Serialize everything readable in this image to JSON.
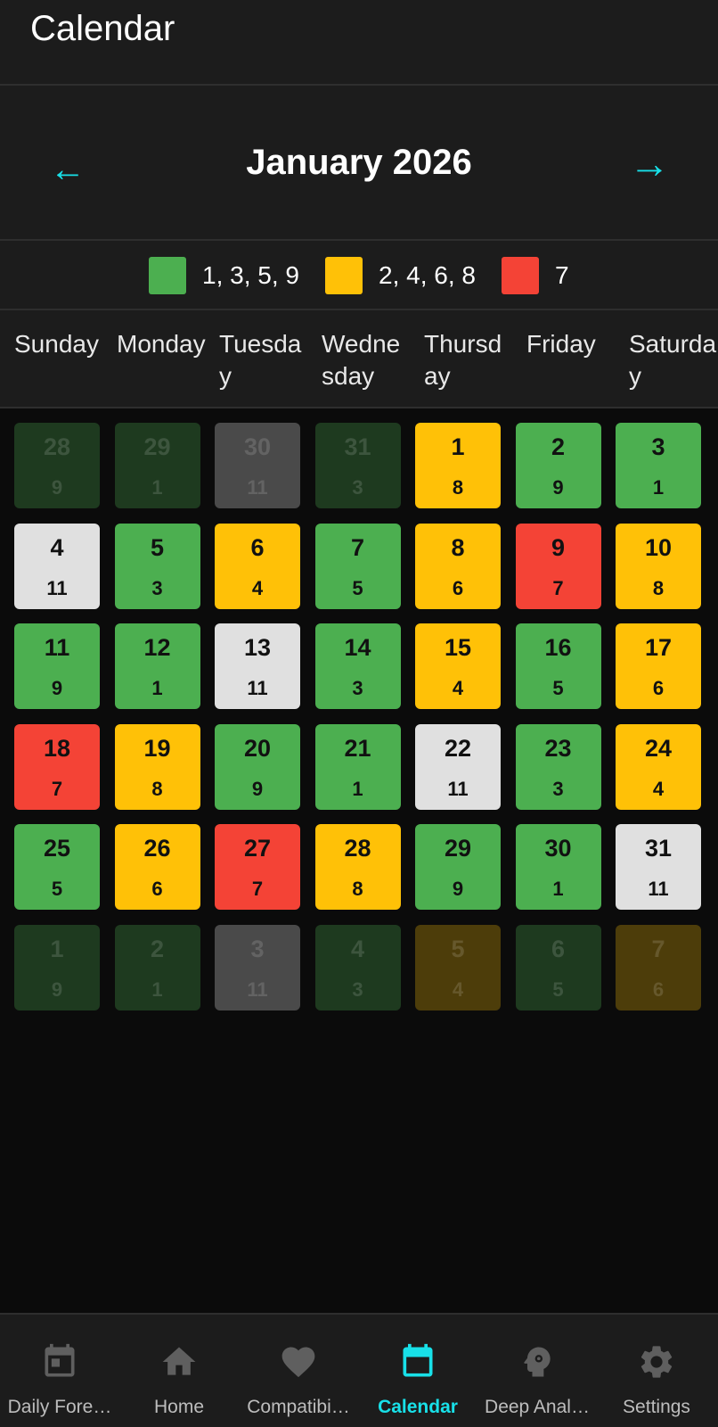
{
  "app": {
    "title": "Calendar"
  },
  "month_nav": {
    "title": "January 2026",
    "prev_icon": "←",
    "next_icon": "→"
  },
  "colors": {
    "green": "#4caf50",
    "yellow": "#ffc107",
    "red": "#f44336",
    "white": "#e0e0e0",
    "accent": "#18e0e8"
  },
  "legend": [
    {
      "label": "1, 3, 5, 9",
      "color": "#4caf50"
    },
    {
      "label": "2, 4, 6, 8",
      "color": "#ffc107"
    },
    {
      "label": "7",
      "color": "#f44336"
    }
  ],
  "weekdays": [
    "Sunday",
    "Monday",
    "Tuesday",
    "Wednesday",
    "Thursday",
    "Friday",
    "Saturday"
  ],
  "weeks": [
    [
      {
        "day": "28",
        "num": "9",
        "color": "green",
        "dim": true
      },
      {
        "day": "29",
        "num": "1",
        "color": "green",
        "dim": true
      },
      {
        "day": "30",
        "num": "11",
        "color": "white",
        "dim": true
      },
      {
        "day": "31",
        "num": "3",
        "color": "green",
        "dim": true
      },
      {
        "day": "1",
        "num": "8",
        "color": "yellow",
        "dim": false
      },
      {
        "day": "2",
        "num": "9",
        "color": "green",
        "dim": false
      },
      {
        "day": "3",
        "num": "1",
        "color": "green",
        "dim": false
      }
    ],
    [
      {
        "day": "4",
        "num": "11",
        "color": "white",
        "dim": false
      },
      {
        "day": "5",
        "num": "3",
        "color": "green",
        "dim": false
      },
      {
        "day": "6",
        "num": "4",
        "color": "yellow",
        "dim": false
      },
      {
        "day": "7",
        "num": "5",
        "color": "green",
        "dim": false
      },
      {
        "day": "8",
        "num": "6",
        "color": "yellow",
        "dim": false
      },
      {
        "day": "9",
        "num": "7",
        "color": "red",
        "dim": false
      },
      {
        "day": "10",
        "num": "8",
        "color": "yellow",
        "dim": false
      }
    ],
    [
      {
        "day": "11",
        "num": "9",
        "color": "green",
        "dim": false
      },
      {
        "day": "12",
        "num": "1",
        "color": "green",
        "dim": false
      },
      {
        "day": "13",
        "num": "11",
        "color": "white",
        "dim": false
      },
      {
        "day": "14",
        "num": "3",
        "color": "green",
        "dim": false
      },
      {
        "day": "15",
        "num": "4",
        "color": "yellow",
        "dim": false
      },
      {
        "day": "16",
        "num": "5",
        "color": "green",
        "dim": false
      },
      {
        "day": "17",
        "num": "6",
        "color": "yellow",
        "dim": false
      }
    ],
    [
      {
        "day": "18",
        "num": "7",
        "color": "red",
        "dim": false
      },
      {
        "day": "19",
        "num": "8",
        "color": "yellow",
        "dim": false
      },
      {
        "day": "20",
        "num": "9",
        "color": "green",
        "dim": false
      },
      {
        "day": "21",
        "num": "1",
        "color": "green",
        "dim": false
      },
      {
        "day": "22",
        "num": "11",
        "color": "white",
        "dim": false
      },
      {
        "day": "23",
        "num": "3",
        "color": "green",
        "dim": false
      },
      {
        "day": "24",
        "num": "4",
        "color": "yellow",
        "dim": false
      }
    ],
    [
      {
        "day": "25",
        "num": "5",
        "color": "green",
        "dim": false
      },
      {
        "day": "26",
        "num": "6",
        "color": "yellow",
        "dim": false
      },
      {
        "day": "27",
        "num": "7",
        "color": "red",
        "dim": false
      },
      {
        "day": "28",
        "num": "8",
        "color": "yellow",
        "dim": false
      },
      {
        "day": "29",
        "num": "9",
        "color": "green",
        "dim": false
      },
      {
        "day": "30",
        "num": "1",
        "color": "green",
        "dim": false
      },
      {
        "day": "31",
        "num": "11",
        "color": "white",
        "dim": false
      }
    ],
    [
      {
        "day": "1",
        "num": "9",
        "color": "green",
        "dim": true
      },
      {
        "day": "2",
        "num": "1",
        "color": "green",
        "dim": true
      },
      {
        "day": "3",
        "num": "11",
        "color": "white",
        "dim": true
      },
      {
        "day": "4",
        "num": "3",
        "color": "green",
        "dim": true
      },
      {
        "day": "5",
        "num": "4",
        "color": "yellow",
        "dim": true
      },
      {
        "day": "6",
        "num": "5",
        "color": "green",
        "dim": true
      },
      {
        "day": "7",
        "num": "6",
        "color": "yellow",
        "dim": true
      }
    ]
  ],
  "bottom_nav": [
    {
      "label": "Daily Fore…",
      "icon": "daily-forecast-icon",
      "active": false
    },
    {
      "label": "Home",
      "icon": "home-icon",
      "active": false
    },
    {
      "label": "Compatibi…",
      "icon": "heart-icon",
      "active": false
    },
    {
      "label": "Calendar",
      "icon": "calendar-icon",
      "active": true
    },
    {
      "label": "Deep Anal…",
      "icon": "head-gear-icon",
      "active": false
    },
    {
      "label": "Settings",
      "icon": "gear-icon",
      "active": false
    }
  ]
}
